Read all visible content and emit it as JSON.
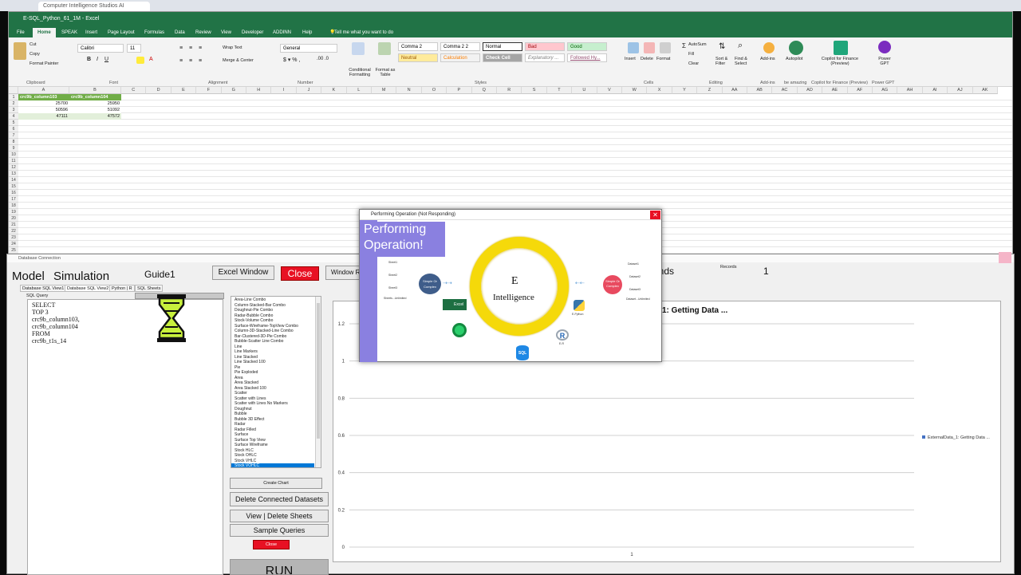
{
  "browser": {
    "tab_title": "Computer Intelligence Studios AI"
  },
  "excel": {
    "title": "E-SQL_Python_61_1M - Excel",
    "tabs": [
      "File",
      "Home",
      "SPEAK",
      "Insert",
      "Page Layout",
      "Formulas",
      "Data",
      "Review",
      "View",
      "Developer",
      "ADDINN",
      "Help"
    ],
    "tell_me": "Tell me what you want to do",
    "ribbon": {
      "clipboard": {
        "cut": "Cut",
        "copy": "Copy",
        "format_painter": "Format Painter",
        "label": "Clipboard"
      },
      "font": {
        "name": "Calibri",
        "size": "11",
        "label": "Font"
      },
      "alignment": {
        "wrap": "Wrap Text",
        "merge": "Merge & Center",
        "label": "Alignment"
      },
      "number": {
        "format": "General",
        "label": "Number"
      },
      "styles": {
        "conditional": "Conditional Formatting",
        "format_table": "Format as Table",
        "boxes": [
          "Comma 2",
          "Comma 2 2",
          "Normal",
          "Bad",
          "Good",
          "Neutral",
          "Calculation",
          "Check Cell",
          "Explanatory ...",
          "Followed Hy..."
        ],
        "label": "Styles"
      },
      "cells": {
        "insert": "Insert",
        "delete": "Delete",
        "format": "Format",
        "label": "Cells"
      },
      "editing": {
        "autosum": "AutoSum",
        "fill": "Fill",
        "clear": "Clear",
        "sort": "Sort & Filter",
        "find": "Find & Select",
        "label": "Editing"
      },
      "addins": {
        "addins": "Add-ins",
        "label": "Add-ins"
      },
      "autopilot": {
        "name": "Autopilot",
        "label": "be amazing"
      },
      "copilot": {
        "name": "Copilot for Finance (Preview)",
        "label": "Copilot for Finance (Preview)"
      },
      "powergpt": {
        "name": "Power GPT",
        "label": "Power GPT"
      }
    },
    "columns": [
      "A",
      "B",
      "C",
      "D",
      "E",
      "F",
      "G",
      "H",
      "I",
      "J",
      "K",
      "L",
      "M",
      "N",
      "O",
      "P",
      "Q",
      "R",
      "S",
      "T",
      "U",
      "V",
      "W",
      "X",
      "Y",
      "Z",
      "AA",
      "AB",
      "AC",
      "AD",
      "AE",
      "AF",
      "AG",
      "AH",
      "AI",
      "AJ",
      "AK"
    ],
    "table": {
      "headers": [
        "crc9b_column103",
        "crc9b_column104"
      ],
      "rows": [
        [
          "25700",
          "25950"
        ],
        [
          "50596",
          "51092"
        ],
        [
          "47111",
          "47572"
        ]
      ]
    }
  },
  "db_window": {
    "title": "Database Connection",
    "model": "Model",
    "simulation": "Simulation",
    "guide": "Guide1",
    "excel_window": "Excel Window",
    "close": "Close",
    "window_resize": "Window R",
    "seconds": "onds",
    "records_label": "Records",
    "records_value": "1",
    "tabs": [
      "Database SQL View1",
      "Database SQL View2",
      "Python | R",
      "SQL Sheets"
    ],
    "sql_query_label": "SQL Query",
    "sql_lines": [
      "SELECT",
      "TOP 3",
      "crc9b_column103,",
      "crc9b_column104",
      "FROM",
      "crc9b_t1s_14"
    ],
    "chart_types": [
      "Area-Line Combo",
      "Column-Stacked-Bar Combo",
      "Doughnut-Pie Combo",
      "Radar-Bubble Combo",
      "Stock-Volume Combo",
      "Surface-Wireframe-TopView Combo",
      "Column-3D-Stacked-Line Combo",
      "Bar-Clustered-3D-Pie Combo",
      "Bubble-Scatter Line Combo",
      "Line",
      "Line Markers",
      "Line Stacked",
      "Line Stacked 100",
      "Pie",
      "Pie Exploded",
      "Area",
      "Area Stacked",
      "Area Stacked 100",
      "Scatter",
      "Scatter with Lines",
      "Scatter with Lines No Markers",
      "Doughnut",
      "Bubble",
      "Bubble 3D Effect",
      "Radar",
      "Radar Filled",
      "Surface",
      "Surface Top View",
      "Surface Wireframe",
      "Stock HLC",
      "Stock OHLC",
      "Stock VHLC",
      "Stock VOHLC"
    ],
    "create_chart": "Create Chart",
    "delete_datasets": "Delete Connected Datasets",
    "view_delete_sheets": "View | Delete Sheets",
    "sample_queries": "Sample Queries",
    "close_small": "Close",
    "run": "RUN",
    "chart_title_partial": "1: Getting Data ...",
    "legend": "ExternalData_1: Getting Data ..."
  },
  "modal": {
    "title": "Performing Operation (Not Responding)",
    "banner": "Performing Operation!",
    "center_line1": "E",
    "center_line2": "Intelligence",
    "left_sheets": [
      "Sheet1",
      "Sheet2",
      "Sheet3",
      "Sheets...Unlimited"
    ],
    "left_node": "Simple Or Complex",
    "right_node": "Simple Or Complex",
    "right_sets": [
      "Dataset1",
      "Dataset2",
      "Dataset3",
      "Dataset...Unlimited"
    ],
    "excel_label": "Excel",
    "python_label": "E-Python",
    "r_label": "E-R",
    "sql_label": "SQL"
  },
  "chart_data": {
    "type": "line",
    "title": "1: Getting Data ...",
    "categories": [
      "1"
    ],
    "series": [
      {
        "name": "ExternalData_1: Getting Data ...",
        "values": []
      }
    ],
    "ylim": [
      0,
      1.2
    ],
    "yticks": [
      "0",
      "0.2",
      "0.4",
      "0.6",
      "0.8",
      "1",
      "1.2"
    ],
    "grid": true,
    "legend": "right"
  }
}
